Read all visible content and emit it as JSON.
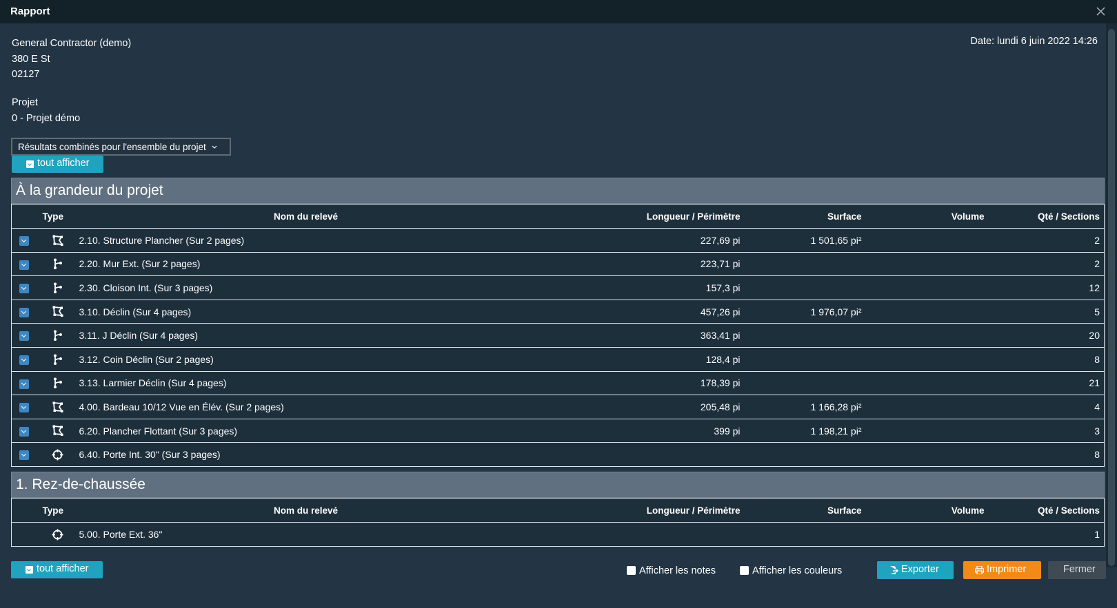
{
  "window": {
    "title": "Rapport"
  },
  "company": {
    "name": "General Contractor (demo)",
    "street": "380 E St",
    "zip": "02127"
  },
  "date": "Date: lundi 6 juin 2022 14:26",
  "project": {
    "label": "Projet",
    "name": "0 - Projet démo"
  },
  "scope_dropdown": {
    "selected": "Résultats combinés pour l'ensemble du projet"
  },
  "show_all_label": "tout afficher",
  "columns": {
    "type": "Type",
    "name": "Nom du relevé",
    "length": "Longueur / Périmètre",
    "surface": "Surface",
    "volume": "Volume",
    "qty": "Qté / Sections"
  },
  "sections": [
    {
      "title": "À la grandeur du projet",
      "rows": [
        {
          "icon": "area-icon",
          "name": "2.10. Structure Plancher (Sur 2 pages)",
          "length": "227,69 pi",
          "surface": "1 501,65 pi²",
          "volume": "",
          "qty": "2"
        },
        {
          "icon": "linear-icon",
          "name": "2.20. Mur Ext. (Sur 2 pages)",
          "length": "223,71 pi",
          "surface": "",
          "volume": "",
          "qty": "2"
        },
        {
          "icon": "linear-icon",
          "name": "2.30. Cloison Int. (Sur 3 pages)",
          "length": "157,3 pi",
          "surface": "",
          "volume": "",
          "qty": "12"
        },
        {
          "icon": "area-icon",
          "name": "3.10. Déclin (Sur 4 pages)",
          "length": "457,26 pi",
          "surface": "1 976,07 pi²",
          "volume": "",
          "qty": "5"
        },
        {
          "icon": "linear-icon",
          "name": "3.11. J Déclin (Sur 4 pages)",
          "length": "363,41 pi",
          "surface": "",
          "volume": "",
          "qty": "20"
        },
        {
          "icon": "linear-icon",
          "name": "3.12. Coin Déclin (Sur 2 pages)",
          "length": "128,4 pi",
          "surface": "",
          "volume": "",
          "qty": "8"
        },
        {
          "icon": "linear-icon",
          "name": "3.13. Larmier Déclin (Sur 4 pages)",
          "length": "178,39 pi",
          "surface": "",
          "volume": "",
          "qty": "21"
        },
        {
          "icon": "area-icon",
          "name": "4.00. Bardeau 10/12 Vue en Élév. (Sur 2 pages)",
          "length": "205,48 pi",
          "surface": "1 166,28 pi²",
          "volume": "",
          "qty": "4"
        },
        {
          "icon": "area-icon",
          "name": "6.20. Plancher Flottant (Sur 3 pages)",
          "length": "399 pi",
          "surface": "1 198,21 pi²",
          "volume": "",
          "qty": "3"
        },
        {
          "icon": "count-icon",
          "name": "6.40. Porte Int. 30\" (Sur 3 pages)",
          "length": "",
          "surface": "",
          "volume": "",
          "qty": "8"
        }
      ]
    },
    {
      "title": "1. Rez-de-chaussée",
      "rows": [
        {
          "icon": "count-icon",
          "name": "5.00. Porte Ext. 36\"",
          "length": "",
          "surface": "",
          "volume": "",
          "qty": "1"
        }
      ]
    }
  ],
  "footer": {
    "show_notes": "Afficher les notes",
    "show_colors": "Afficher les couleurs",
    "export": "Exporter",
    "print": "Imprimer",
    "close": "Fermer"
  },
  "colors": {
    "accent": "#1fa3bf",
    "print": "#f28a17",
    "background": "#233545"
  }
}
